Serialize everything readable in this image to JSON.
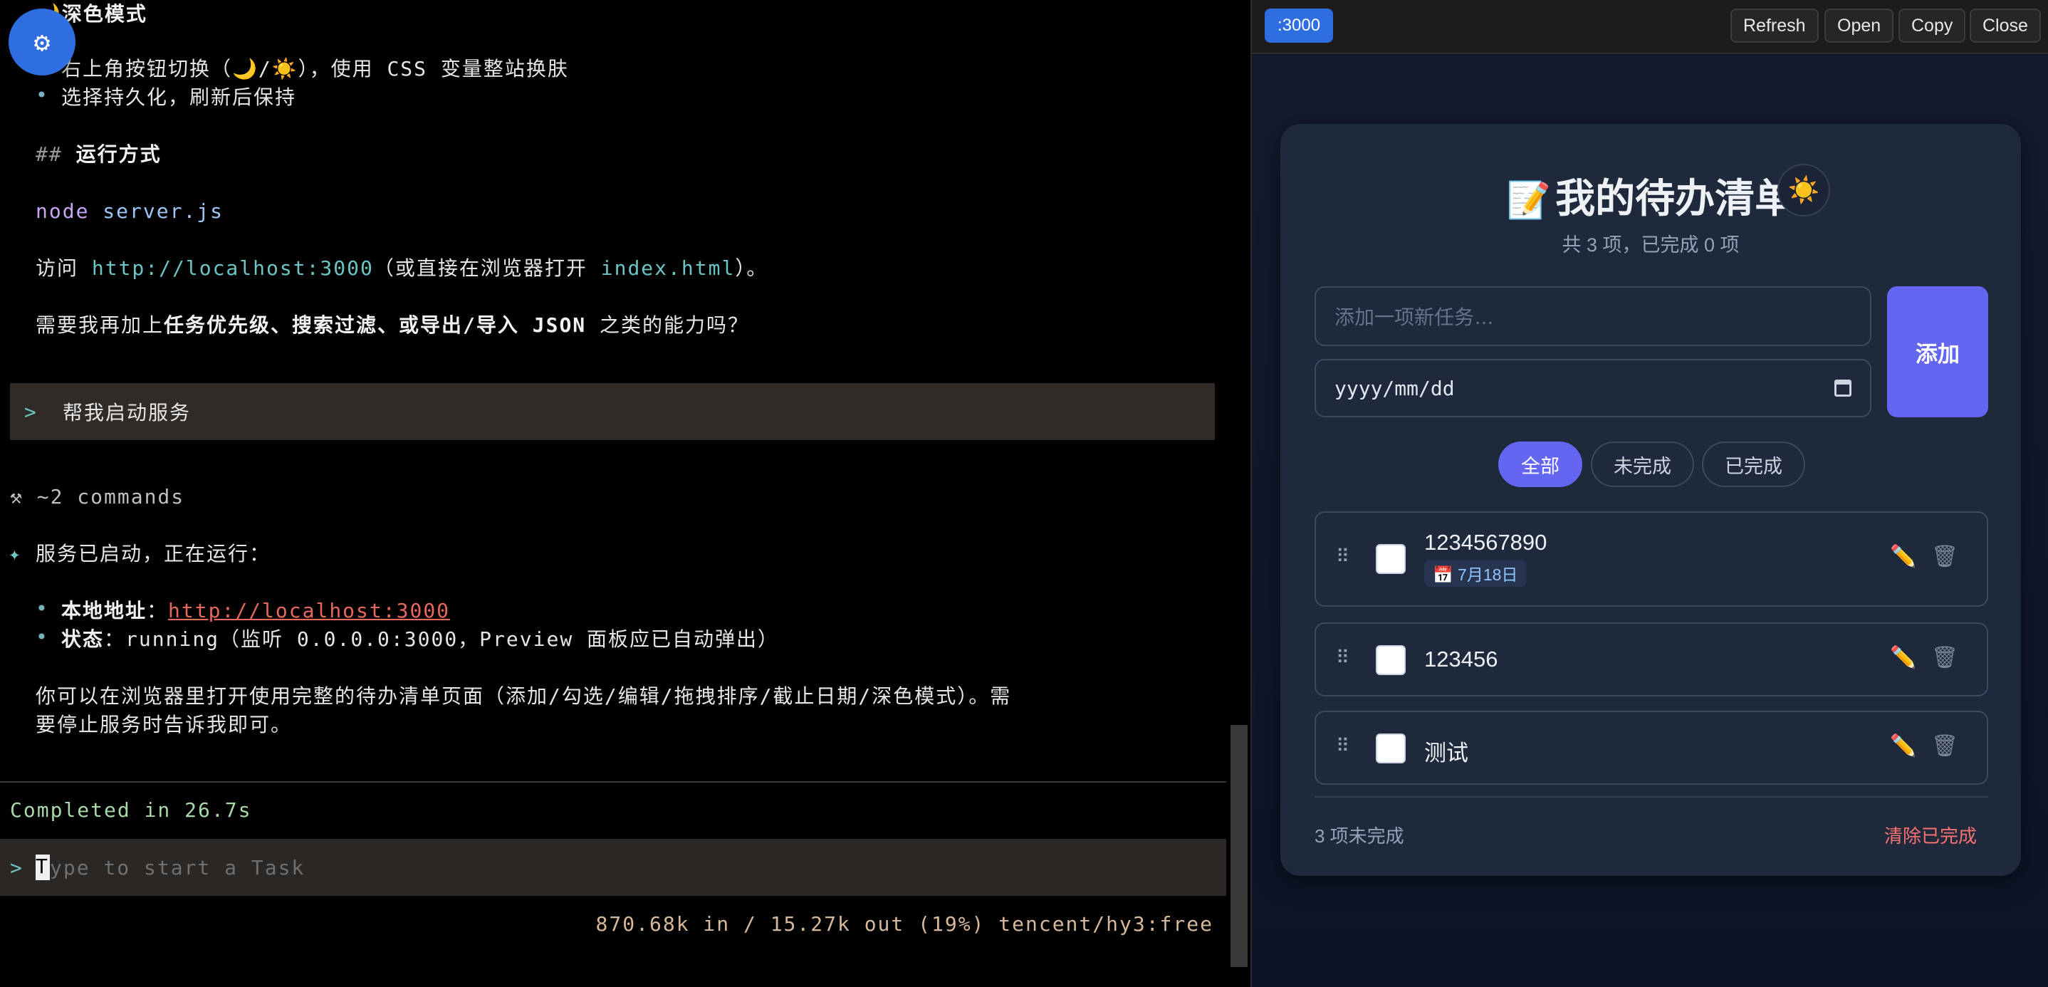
{
  "terminal": {
    "line_dark_mode": "🌙深色模式",
    "b1": "右上角按钮切换（🌙/☀️），使用 CSS 变量整站换肤",
    "b2": "选择持久化，刷新后保持",
    "h_hashes": "##",
    "h_run": "运行方式",
    "cmd_node": "node",
    "cmd_file": "server.js",
    "visit_prefix": "访问 ",
    "visit_url": "http://localhost:3000",
    "visit_mid": "（或直接在浏览器打开 ",
    "visit_file": "index.html",
    "visit_suffix": "）。",
    "q_prefix": "需要我再加上",
    "q_bold": "任务优先级、搜索过滤、或导出/导入 JSON",
    "q_suffix": " 之类的能力吗？",
    "prompt_arrow": ">",
    "prompt_text": "帮我启动服务",
    "tool_icon": "⚒",
    "tool_text": "~2 commands",
    "star": "✦",
    "started": "服务已启动，正在运行：",
    "addr_label": "本地地址",
    "addr_sep": "：",
    "addr_url": "http://localhost:3000",
    "status_label": "状态",
    "status_sep": "：",
    "status_value": "running（监听 0.0.0.0:3000，Preview 面板应已自动弹出）",
    "para1": "你可以在浏览器里打开使用完整的待办清单页面（添加/勾选/编辑/拖拽排序/截止日期/深色模式）。需",
    "para2": "要停止服务时告诉我即可。",
    "completed": "Completed in 26.7s",
    "input_arrow": ">",
    "input_placeholder_first": "T",
    "input_placeholder_rest": "ype to start a Task",
    "status_bar": "870.68k in / 15.27k out (19%)  tencent/hy3:free",
    "bullet": "•",
    "gear_icon": "⚙"
  },
  "preview": {
    "port": ":3000",
    "toolbar": {
      "refresh": "Refresh",
      "open": "Open",
      "copy": "Copy",
      "close": "Close"
    },
    "title_icon": "📝",
    "title": "我的待办清单",
    "theme_icon": "☀️",
    "summary": "共 3 项，已完成 0 项",
    "input_placeholder": "添加一项新任务…",
    "date_placeholder": "yyyy/mm/dd",
    "add_label": "添加",
    "filters": {
      "all": "全部",
      "active": "未完成",
      "done": "已完成"
    },
    "todos": [
      {
        "text": "1234567890",
        "due": "📅 7月18日",
        "checked": false
      },
      {
        "text": "123456",
        "checked": false
      },
      {
        "text": "测试",
        "checked": false
      }
    ],
    "drag_icon": "⠿",
    "edit_icon": "✏️",
    "delete_icon": "🗑",
    "remaining": "3 项未完成",
    "clear_done": "清除已完成"
  },
  "colors": {
    "accent": "#6366f1",
    "terminal_bg": "#000000",
    "card_bg": "#1e293b",
    "danger": "#f87171",
    "port_badge": "#2f6ee0"
  }
}
